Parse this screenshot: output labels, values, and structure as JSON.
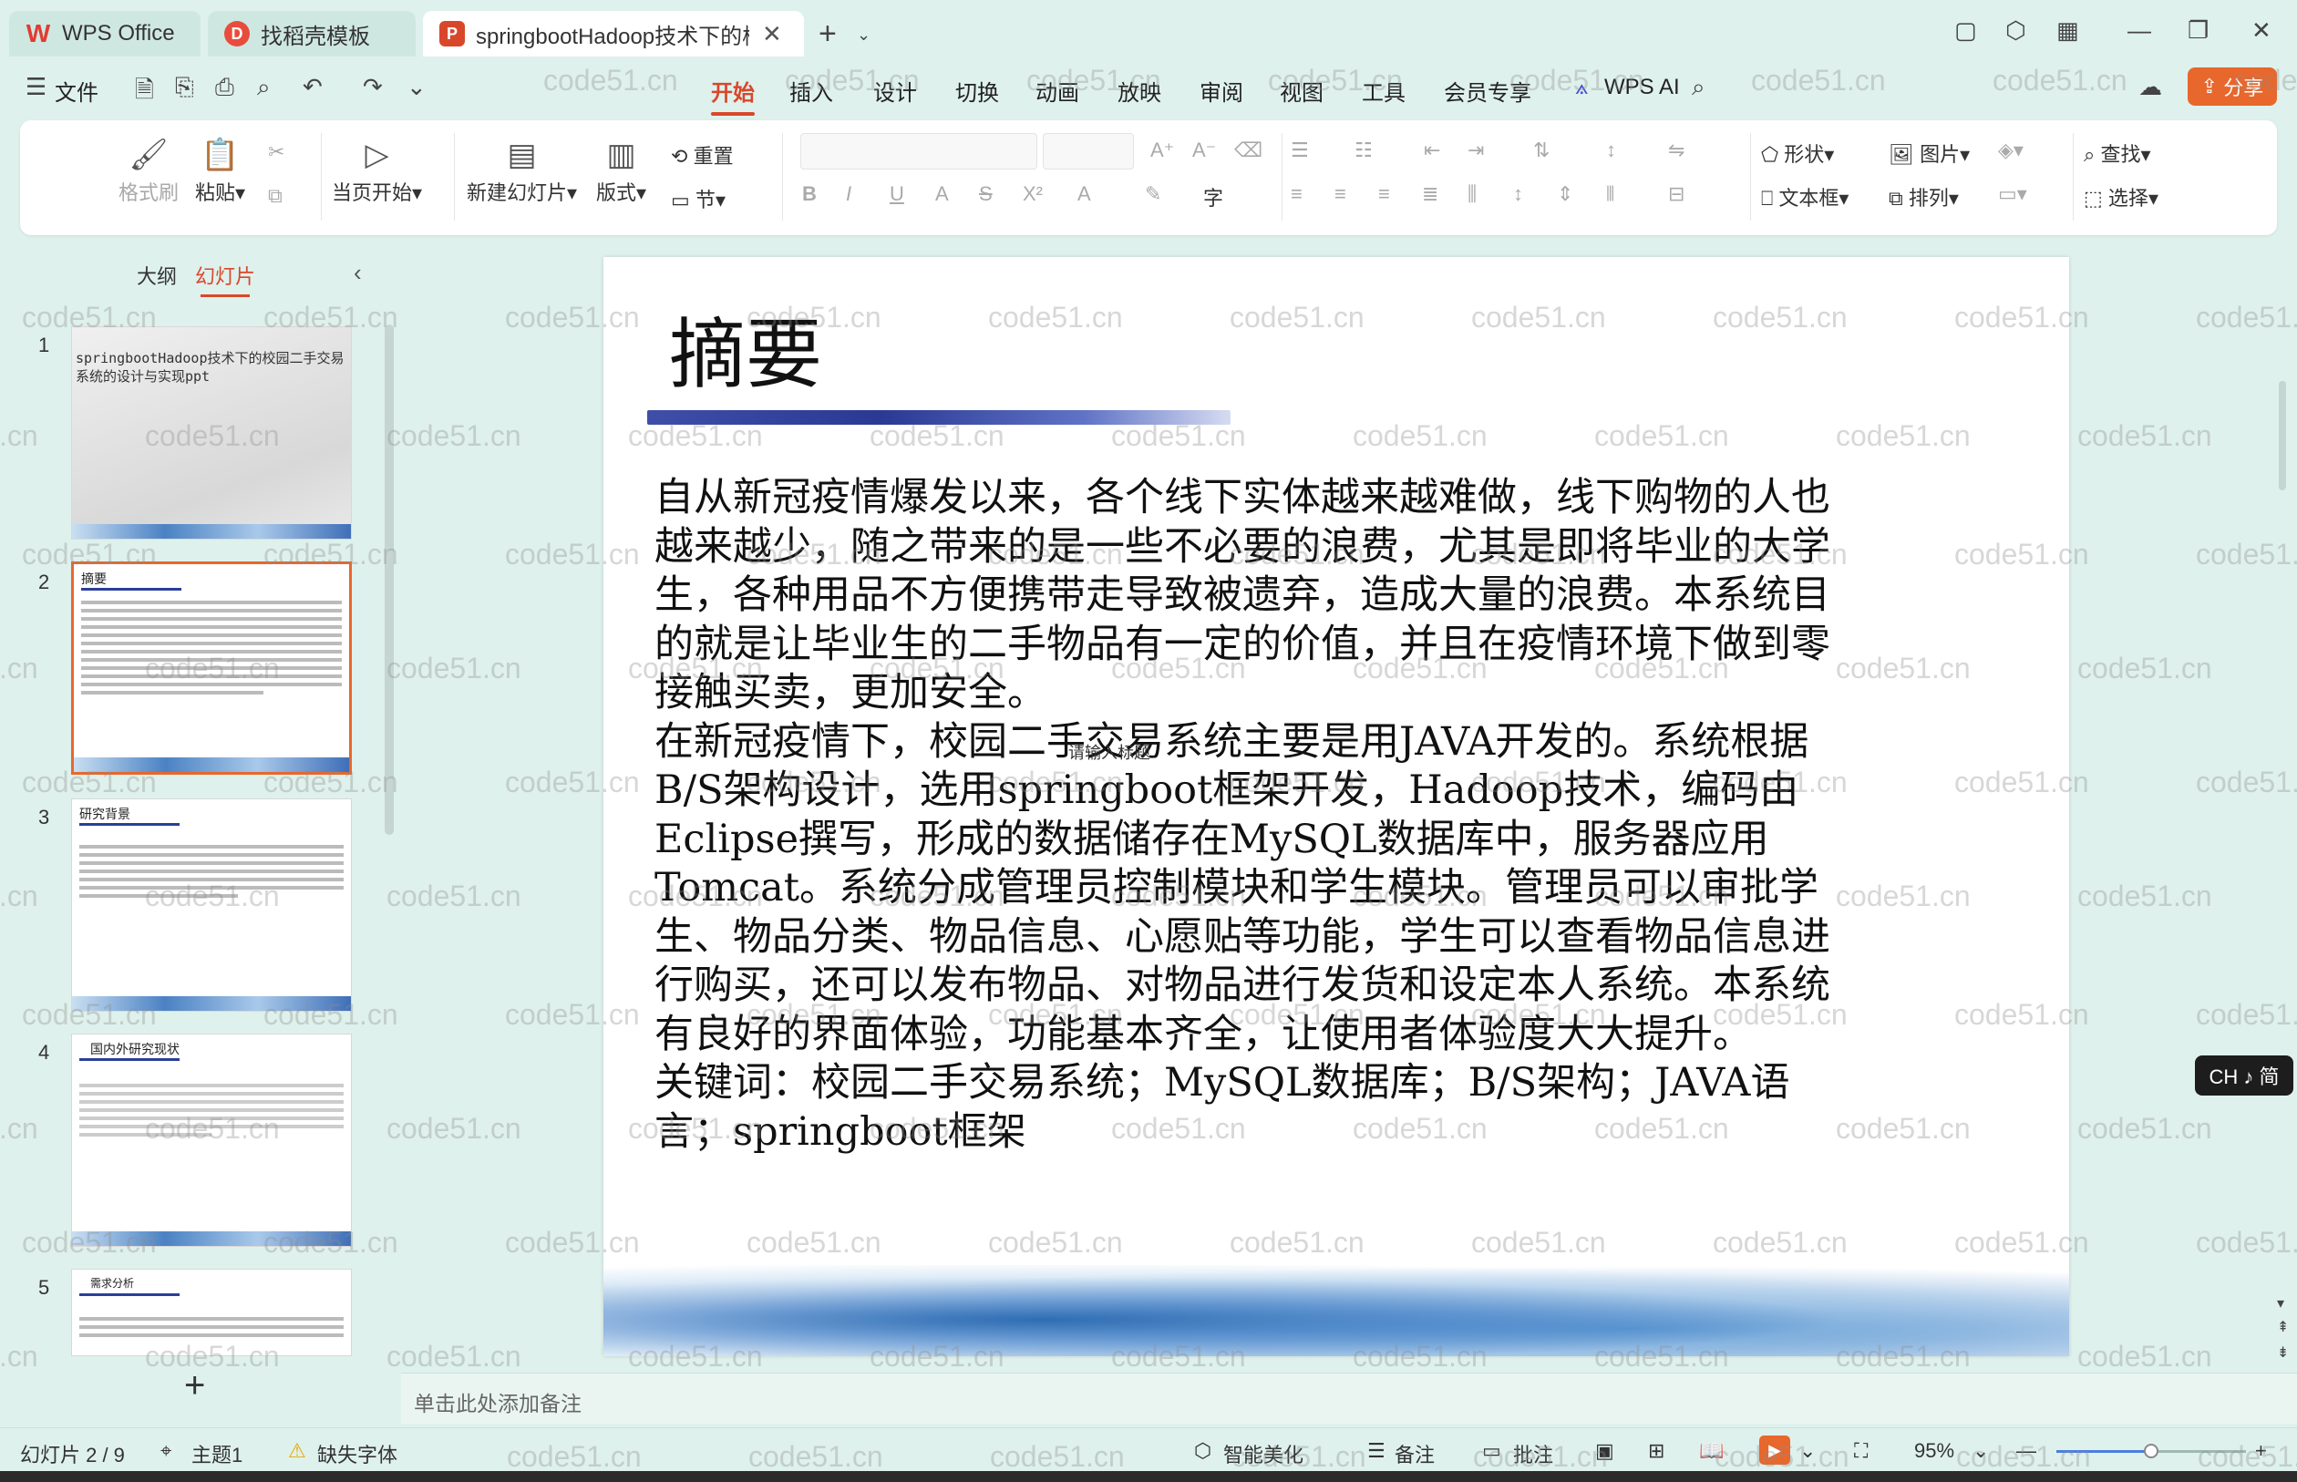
{
  "tabs": {
    "wps": "WPS Office",
    "template": "找稻壳模板",
    "doc": "springbootHadoop技术下的校园二手交易系统的设计与实现ppt"
  },
  "menu": {
    "file": "文件",
    "items": [
      "开始",
      "插入",
      "设计",
      "切换",
      "动画",
      "放映",
      "审阅",
      "视图",
      "工具",
      "会员专享"
    ],
    "wps_ai": "WPS AI",
    "share": "分享"
  },
  "ribbon": {
    "format_painter": "格式刷",
    "paste": "粘贴",
    "start_from_current": "当页开始",
    "new_slide": "新建幻灯片",
    "layout": "版式",
    "reset": "重置",
    "section": "节",
    "shape": "形状",
    "picture": "图片",
    "find": "查找",
    "textbox": "文本框",
    "arrange": "排列",
    "select": "选择"
  },
  "left_panel": {
    "tab_outline": "大纲",
    "tab_slides": "幻灯片",
    "slides": [
      {
        "num": "1",
        "title": "springbootHadoop技术下的校园二手交易系统的设计与实现ppt"
      },
      {
        "num": "2",
        "title": "摘要"
      },
      {
        "num": "3",
        "title": "研究背景"
      },
      {
        "num": "4",
        "title": "国内外研究现状"
      },
      {
        "num": "5",
        "title": "需求分析"
      }
    ]
  },
  "slide": {
    "title": "摘要",
    "paragraphs": [
      "自从新冠疫情爆发以来，各个线下实体越来越难做，线下购物的人也越来越少，随之带来的是一些不必要的浪费，尤其是即将毕业的大学生，各种用品不方便携带走导致被遗弃，造成大量的浪费。本系统目的就是让毕业生的二手物品有一定的价值，并且在疫情环境下做到零接触买卖，更加安全。",
      "在新冠疫情下，校园二手交易系统主要是用JAVA开发的。系统根据B/S架构设计，选用springboot框架开发，Hadoop技术，编码由Eclipse撰写，形成的数据储存在MySQL数据库中，服务器应用Tomcat。系统分成管理员控制模块和学生模块。管理员可以审批学生、物品分类、物品信息、心愿贴等功能，学生可以查看物品信息进行购买，还可以发布物品、对物品进行发货和设定本人系统。本系统有良好的界面体验，功能基本齐全，让使用者体验度大大提升。",
      "关键词：校园二手交易系统；MySQL数据库；B/S架构；JAVA语言；springboot框架"
    ],
    "overlay_text": "请输入标题"
  },
  "ime": "CH ♪ 简",
  "notes_placeholder": "单击此处添加备注",
  "status": {
    "slide_counter": "幻灯片 2 / 9",
    "theme": "主题1",
    "missing_font": "缺失字体",
    "smart_beautify": "智能美化",
    "notes": "备注",
    "comments": "批注",
    "zoom": "95%",
    "zoom_fraction": 0.5
  },
  "watermark": "code51.cn",
  "colors": {
    "accent": "#d9472b",
    "share": "#e8672c",
    "background": "#dff1ec",
    "title_bar": "#2a3994"
  }
}
